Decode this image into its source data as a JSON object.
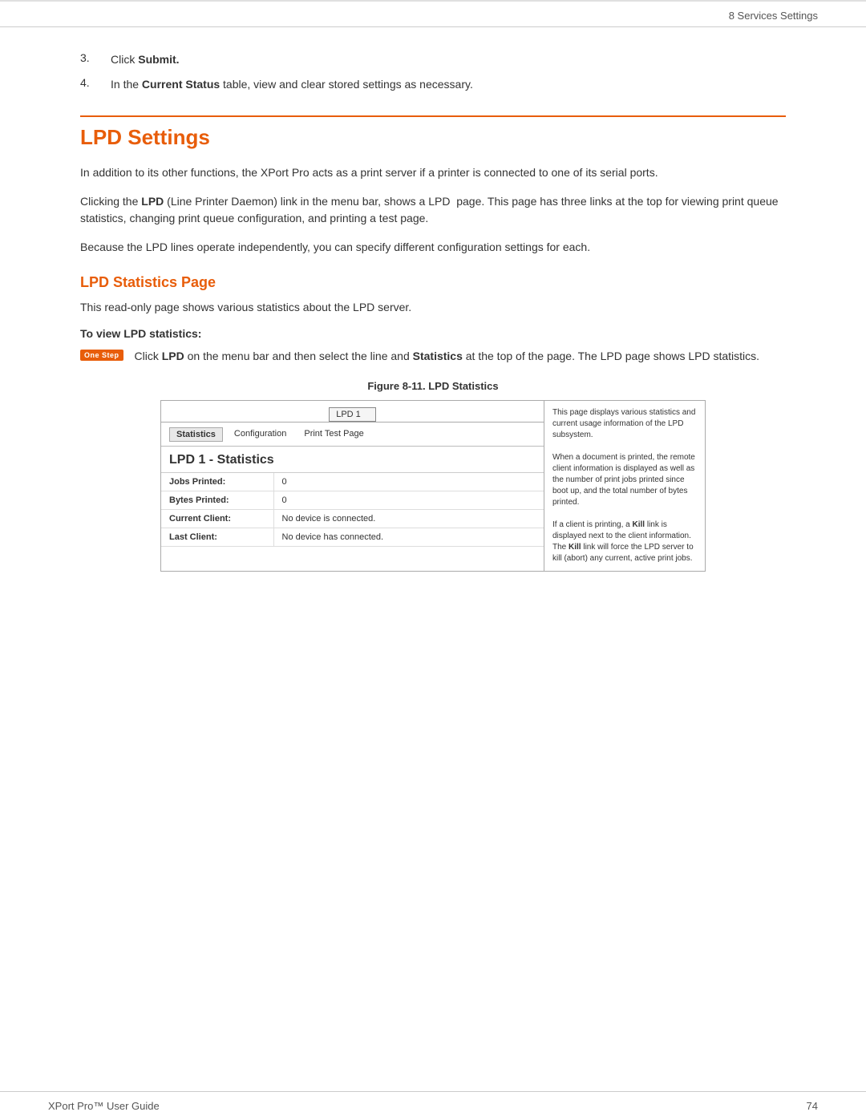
{
  "header": {
    "title": "8 Services Settings"
  },
  "steps": [
    {
      "number": "3.",
      "text": "Click ",
      "bold": "Submit."
    },
    {
      "number": "4.",
      "text_before": "In the ",
      "bold": "Current Status",
      "text_after": " table, view and clear stored settings as necessary."
    }
  ],
  "lpd_settings": {
    "heading": "LPD Settings",
    "para1": "In addition to its other functions, the XPort Pro acts as a print server if a printer is connected to one of its serial ports.",
    "para2_before": "Clicking the ",
    "para2_bold": "LPD",
    "para2_mid": " (Line Printer Daemon) link in the menu bar, shows a LPD  page. This page has three links at the top for viewing print queue statistics, changing print queue configuration, and printing a test page.",
    "para3": "Because the LPD lines operate independently, you can specify different configuration settings for each."
  },
  "lpd_statistics_page": {
    "heading": "LPD Statistics Page",
    "para": "This read-only page shows various statistics about the LPD server.",
    "procedure_label": "To view LPD statistics:",
    "onestep_badge": "One Step",
    "onestep_before": "Click ",
    "onestep_bold1": "LPD",
    "onestep_mid": " on the menu bar and then select the line and ",
    "onestep_bold2": "Statistics",
    "onestep_after": " at the top of the page. The LPD page shows LPD statistics.",
    "figure_caption": "Figure 8-11. LPD Statistics"
  },
  "screenshot": {
    "lpd_selector_label": "LPD 1",
    "tabs": [
      "Statistics",
      "Configuration",
      "Print Test Page"
    ],
    "active_tab": "Statistics",
    "main_heading": "LPD 1 - Statistics",
    "table_rows": [
      {
        "label": "Jobs Printed:",
        "value": "0"
      },
      {
        "label": "Bytes Printed:",
        "value": "0"
      },
      {
        "label": "Current Client:",
        "value": "No device is connected."
      },
      {
        "label": "Last Client:",
        "value": "No device has connected."
      }
    ],
    "sidebar_text": "This page displays various statistics and current usage information of the LPD subsystem.\n\nWhen a document is printed, the remote client information is displayed as well as the number of print jobs printed since boot up, and the total number of bytes printed.\n\nIf a client is printing, a Kill link is displayed next to the client information. The Kill link will force the LPD server to kill (abort) any current, active print jobs."
  },
  "footer": {
    "left": "XPort Pro™ User Guide",
    "right": "74"
  }
}
